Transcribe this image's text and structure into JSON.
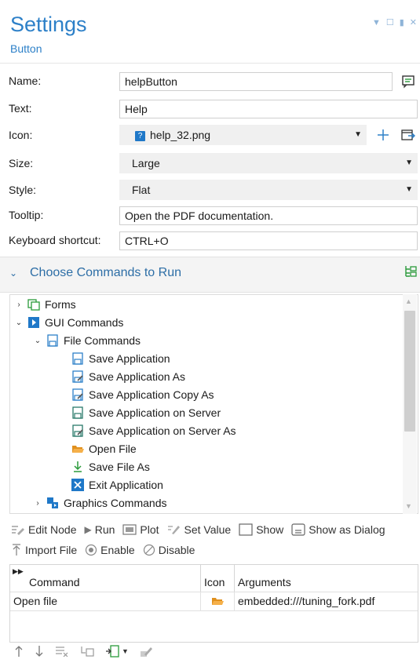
{
  "header": {
    "title": "Settings",
    "subtitle": "Button"
  },
  "form": {
    "name_label": "Name:",
    "name_value": "helpButton",
    "text_label": "Text:",
    "text_value": "Help",
    "icon_label": "Icon:",
    "icon_value": "help_32.png",
    "size_label": "Size:",
    "size_value": "Large",
    "style_label": "Style:",
    "style_value": "Flat",
    "tooltip_label": "Tooltip:",
    "tooltip_value": "Open the PDF documentation.",
    "shortcut_label": "Keyboard shortcut:",
    "shortcut_value": "CTRL+O"
  },
  "commands_section": {
    "title": "Choose Commands to Run"
  },
  "tree": {
    "forms": "Forms",
    "gui_commands": "GUI Commands",
    "file_commands": "File Commands",
    "items": [
      "Save Application",
      "Save Application As",
      "Save Application Copy As",
      "Save Application on Server",
      "Save Application on Server As",
      "Open File",
      "Save File As",
      "Exit Application"
    ],
    "graphics_commands": "Graphics Commands"
  },
  "toolbar": {
    "edit_node": "Edit Node",
    "run": "Run",
    "plot": "Plot",
    "set_value": "Set Value",
    "show": "Show",
    "show_as_dialog": "Show as Dialog",
    "import_file": "Import File",
    "enable": "Enable",
    "disable": "Disable"
  },
  "table": {
    "headers": [
      "Command",
      "Icon",
      "Arguments"
    ],
    "rows": [
      {
        "command": "Open file",
        "arguments": "embedded:///tuning_fork.pdf"
      }
    ]
  },
  "colors": {
    "accent": "#2d80c8",
    "folder": "#f0a030",
    "blue_icon": "#1f78c8"
  }
}
